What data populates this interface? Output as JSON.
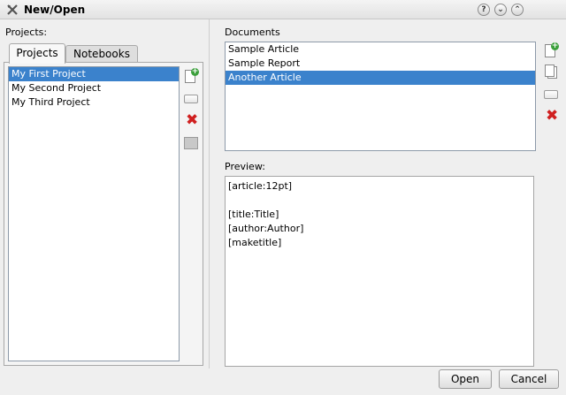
{
  "window": {
    "title": "New/Open",
    "controls": {
      "help": "?",
      "minimize": "⌄",
      "maximize": "⌃"
    }
  },
  "projects": {
    "label": "Projects:",
    "tabs": [
      {
        "label": "Projects",
        "active": true
      },
      {
        "label": "Notebooks",
        "active": false
      }
    ],
    "items": [
      {
        "label": "My First Project",
        "selected": true
      },
      {
        "label": "My Second Project",
        "selected": false
      },
      {
        "label": "My Third Project",
        "selected": false
      }
    ],
    "side_buttons": [
      "new-project-icon",
      "rename-project-icon",
      "delete-project-icon",
      "notebook-icon"
    ]
  },
  "documents": {
    "label": "Documents",
    "items": [
      {
        "label": "Sample Article",
        "selected": false
      },
      {
        "label": "Sample Report",
        "selected": false
      },
      {
        "label": "Another Article",
        "selected": true
      }
    ],
    "side_buttons": [
      "new-document-icon",
      "copy-document-icon",
      "rename-document-icon",
      "delete-document-icon"
    ]
  },
  "preview": {
    "label": "Preview:",
    "lines": [
      "[article:12pt]",
      "",
      "[title:Title]",
      "[author:Author]",
      "[maketitle]"
    ]
  },
  "buttons": {
    "open": "Open",
    "cancel": "Cancel"
  },
  "colors": {
    "selection": "#3b82cc",
    "delete": "#d02020",
    "add": "#3ca03c"
  }
}
